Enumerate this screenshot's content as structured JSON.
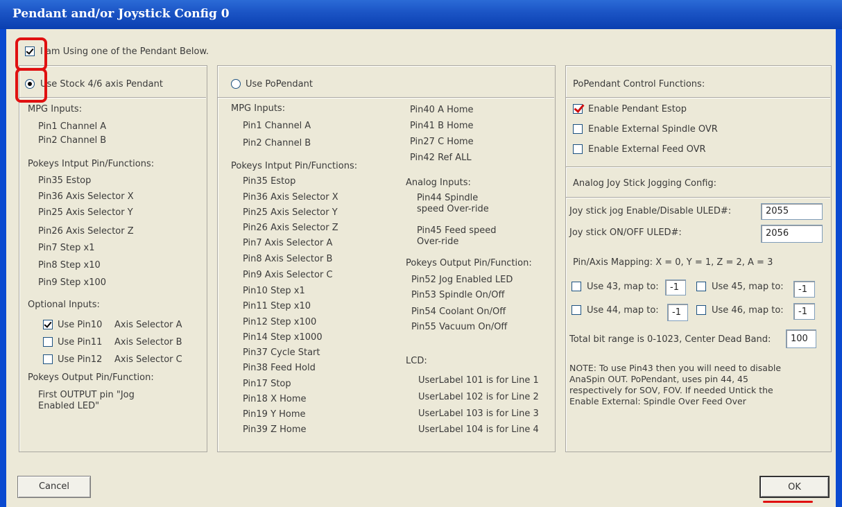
{
  "window": {
    "title": "Pendant and/or Joystick Config 0"
  },
  "top_option": {
    "label": "I am Using one of the  Pendant Below.",
    "checked": true
  },
  "stock": {
    "radio_label": "Use Stock 4/6 axis Pendant",
    "mpg_heading": "MPG Inputs:",
    "mpg": [
      "Pin1  Channel A",
      "Pin2  Channel B"
    ],
    "pokeys_heading": "Pokeys Intput Pin/Functions:",
    "pins": [
      "Pin35  Estop",
      "Pin36  Axis Selector X",
      "Pin25  Axis Selector Y",
      "Pin26  Axis Selector Z",
      "Pin7  Step x1",
      "Pin8  Step x10",
      "Pin9  Step x100"
    ],
    "optional_heading": "Optional Inputs:",
    "optional": [
      {
        "pin": "Use Pin10",
        "fn": "Axis Selector A",
        "checked": true
      },
      {
        "pin": "Use Pin11",
        "fn": "Axis Selector B",
        "checked": false
      },
      {
        "pin": "Use Pin12",
        "fn": "Axis Selector C",
        "checked": false
      }
    ],
    "output_heading": "Pokeys Output Pin/Function:",
    "output_line1": "First OUTPUT pin \"Jog",
    "output_line2": "Enabled LED\""
  },
  "popendant": {
    "radio_label": "Use PoPendant",
    "mpg_heading": "MPG Inputs:",
    "mpg": [
      "Pin1  Channel A",
      "Pin2  Channel B"
    ],
    "pokeys_heading": "Pokeys Intput Pin/Functions:",
    "pins": [
      "Pin35  Estop",
      "Pin36  Axis Selector X",
      "Pin25  Axis Selector Y",
      "Pin26  Axis Selector Z",
      "Pin7  Axis Selector A",
      "Pin8  Axis Selector B",
      "Pin9  Axis Selector C",
      "Pin10  Step x1",
      "Pin11  Step x10",
      "Pin12  Step x100",
      "Pin14  Step x1000",
      "Pin37  Cycle Start",
      "Pin38  Feed Hold",
      "Pin17  Stop",
      "Pin18  X Home",
      "Pin19  Y Home",
      "Pin39  Z Home"
    ],
    "home_pins": [
      "Pin40  A Home",
      "Pin41  B Home",
      "Pin27  C Home",
      "Pin42  Ref ALL"
    ],
    "analog_heading": "Analog Inputs:",
    "analog1_line1": "Pin44  Spindle",
    "analog1_line2": "speed Over-ride",
    "analog2_line1": "Pin45  Feed speed",
    "analog2_line2": "Over-ride",
    "output_heading": "Pokeys Output Pin/Function:",
    "outputs": [
      "Pin52  Jog Enabled LED",
      "Pin53  Spindle On/Off",
      "Pin54  Coolant On/Off",
      "Pin55  Vacuum On/Off"
    ],
    "lcd_heading": "LCD:",
    "lcd": [
      "UserLabel 101 is for Line 1",
      "UserLabel 102 is for Line 2",
      "UserLabel 103 is for Line 3",
      "UserLabel 104 is for Line 4"
    ]
  },
  "control": {
    "heading": "PoPendant Control Functions:",
    "items": [
      {
        "label": "Enable Pendant Estop",
        "checked": true
      },
      {
        "label": "Enable External Spindle OVR",
        "checked": false
      },
      {
        "label": "Enable External Feed OVR",
        "checked": false
      }
    ]
  },
  "joystick": {
    "heading": "Analog Joy Stick Jogging Config:",
    "enable_label": "Joy stick jog Enable/Disable ULED#:",
    "enable_value": "2055",
    "onoff_label": "Joy stick ON/OFF ULED#:",
    "onoff_value": "2056",
    "mapping_text": "Pin/Axis Mapping:  X  = 0, Y = 1, Z = 2, A = 3",
    "map43_label": "Use 43, map to:",
    "map43_value": "-1",
    "map45_label": "Use 45, map to:",
    "map45_value": "-1",
    "map44_label": "Use 44, map to:",
    "map44_value": "-1",
    "map46_label": "Use 46, map to:",
    "map46_value": "-1",
    "deadband_label": "Total bit range is 0-1023, Center Dead Band:",
    "deadband_value": "100",
    "note": [
      "NOTE: To use Pin43 then you will need to disable",
      "AnaSpin OUT. PoPendant, uses pin 44, 45",
      "respectively for SOV, FOV. If needed Untick the",
      "Enable External: Spindle Over  Feed Over"
    ]
  },
  "buttons": {
    "cancel": "Cancel",
    "ok": "OK"
  },
  "colors": {
    "title_bar": "#1a53c4",
    "dialog_bg": "#ece9d8",
    "annotation": "#e01010"
  }
}
